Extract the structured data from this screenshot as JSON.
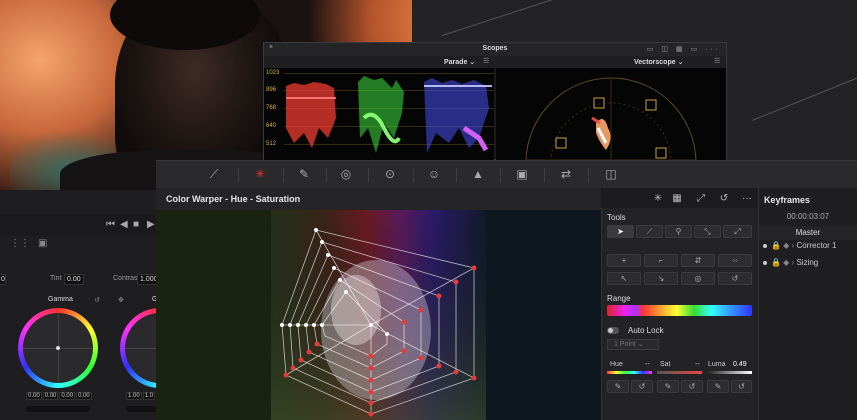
{
  "scopes": {
    "title": "Scopes",
    "close": "×",
    "left_scope": "Parade ⌄",
    "right_scope": "Vectorscope ⌄",
    "window_buttons": "▭ ◫ ▦ ▭ ···",
    "parade_labels": [
      "1023",
      "896",
      "768",
      "640",
      "512"
    ]
  },
  "left_panel": {
    "tint_label": "Tint",
    "tint_value": "0.00",
    "contrast_label": "Contrast",
    "contrast_value": "1.000",
    "first_value": "0",
    "gamma_label": "Gamma",
    "gain_label": "G",
    "gamma_values": [
      "0.00",
      "0.00",
      "0.00",
      "0.00"
    ],
    "gain_values": [
      "1.00",
      "1.0"
    ]
  },
  "warper": {
    "title": "Color Warper - Hue - Saturation"
  },
  "tools": {
    "heading": "Tools",
    "range_heading": "Range",
    "autolock": "Auto Lock",
    "point_select": "1 Point   ⌄",
    "hue_label": "Hue",
    "hue_value": "--",
    "sat_label": "Sat",
    "sat_value": "--",
    "luma_label": "Luma",
    "luma_value": "0.49"
  },
  "keyframes": {
    "title": "Keyframes",
    "timecode": "00:00:03:07",
    "master": "Master",
    "rows": [
      "Corrector 1",
      "Sizing"
    ]
  }
}
